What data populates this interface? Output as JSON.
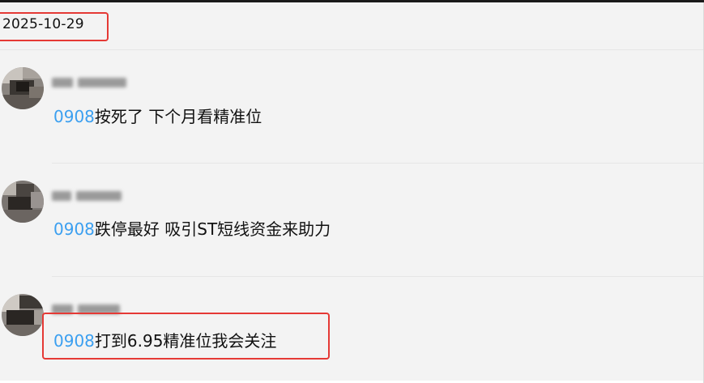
{
  "date": "2025-10-29",
  "comments": [
    {
      "stock_code": "0908",
      "text": "按死了 下个月看精准位",
      "highlighted": false
    },
    {
      "stock_code": "0908",
      "text": "跌停最好 吸引ST短线资金来助力",
      "highlighted": false
    },
    {
      "stock_code": "0908",
      "text": "打到6.95精准位我会关注",
      "highlighted": true
    }
  ],
  "colors": {
    "highlight_border": "#e53935",
    "stock_code": "#3b9ff0",
    "background": "#f3f3f3"
  }
}
